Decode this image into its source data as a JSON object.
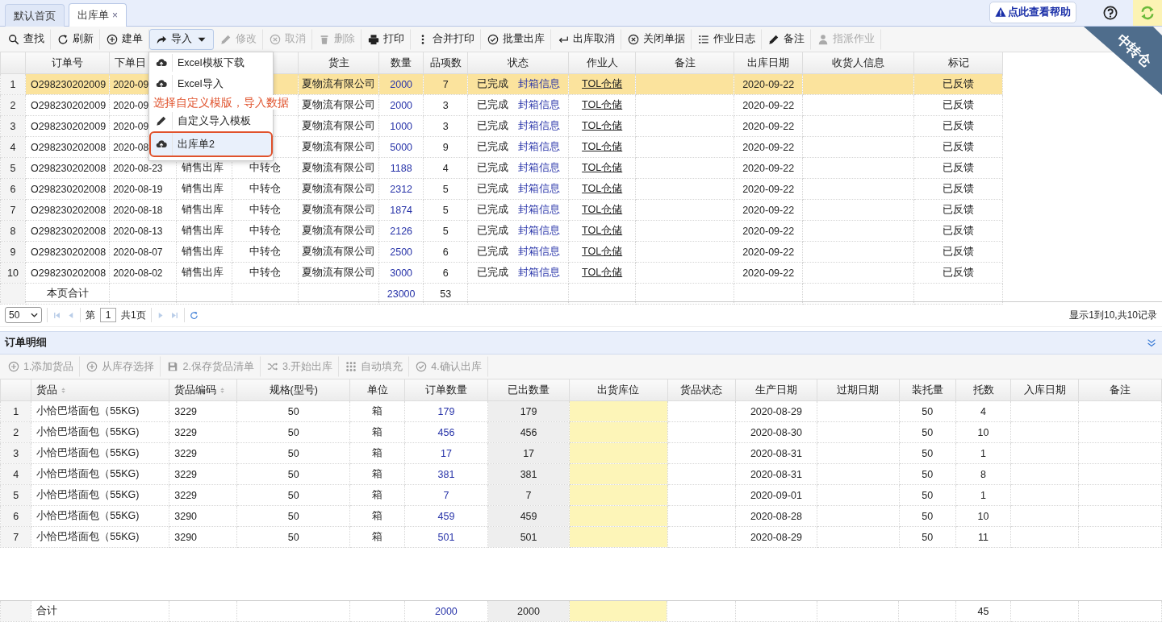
{
  "tabs": [
    {
      "label": "默认首页",
      "selected": false
    },
    {
      "label": "出库单",
      "selected": true,
      "close": "×"
    }
  ],
  "help": {
    "label": "点此查看帮助"
  },
  "ribbon": "中转仓",
  "toolbar": [
    {
      "label": "查找",
      "disabled": false,
      "expanded": false
    },
    {
      "label": "刷新",
      "disabled": false,
      "expanded": false
    },
    {
      "label": "建单",
      "disabled": false,
      "expanded": false
    },
    {
      "label": "导入",
      "disabled": false,
      "expanded": true
    },
    {
      "label": "修改",
      "disabled": true,
      "expanded": false
    },
    {
      "label": "取消",
      "disabled": true,
      "expanded": false
    },
    {
      "label": "删除",
      "disabled": true,
      "expanded": false
    },
    {
      "label": "打印",
      "disabled": false,
      "expanded": false
    },
    {
      "label": "合并打印",
      "disabled": false,
      "expanded": false
    },
    {
      "label": "批量出库",
      "disabled": false,
      "expanded": false
    },
    {
      "label": "出库取消",
      "disabled": false,
      "expanded": false
    },
    {
      "label": "关闭单据",
      "disabled": false,
      "expanded": false
    },
    {
      "label": "作业日志",
      "disabled": false,
      "expanded": false
    },
    {
      "label": "备注",
      "disabled": false,
      "expanded": false
    },
    {
      "label": "指派作业",
      "disabled": true,
      "expanded": false
    }
  ],
  "import_menu": [
    {
      "label": "Excel模板下载",
      "selected": false
    },
    {
      "label": "Excel导入",
      "selected": false
    },
    {
      "label": "自定义导入模板",
      "selected": false
    },
    {
      "label": "出库单2",
      "selected": true
    }
  ],
  "annotation": "选择自定义模版，导入数据",
  "orders": {
    "columns": {
      "order": "订单号",
      "date": "下单日",
      "owner": "货主",
      "qty": "数量",
      "items": "品项数",
      "status": "状态",
      "operator": "作业人",
      "note": "备注",
      "ship_date": "出库日期",
      "consignee": "收货人信息",
      "mark": "标记"
    },
    "rows": [
      {
        "selected": true,
        "no": "1",
        "order": "O298230202009",
        "date": "2020-09",
        "owner": "夏物流有限公司",
        "qty": "2000",
        "items": "7",
        "status": "已完成",
        "box_info": "封箱信息",
        "operator": "TOL仓储",
        "ship_date": "2020-09-22",
        "mark": "已反馈"
      },
      {
        "selected": false,
        "no": "2",
        "order": "O298230202009",
        "date": "2020-09",
        "owner": "夏物流有限公司",
        "qty": "2000",
        "items": "3",
        "status": "已完成",
        "box_info": "封箱信息",
        "operator": "TOL仓储",
        "ship_date": "2020-09-22",
        "mark": "已反馈"
      },
      {
        "selected": false,
        "no": "3",
        "order": "O298230202009",
        "date": "2020-09",
        "owner": "夏物流有限公司",
        "qty": "1000",
        "items": "3",
        "status": "已完成",
        "box_info": "封箱信息",
        "operator": "TOL仓储",
        "ship_date": "2020-09-22",
        "mark": "已反馈"
      },
      {
        "selected": false,
        "no": "4",
        "order": "O298230202008",
        "date": "2020-08",
        "owner": "夏物流有限公司",
        "qty": "5000",
        "items": "9",
        "status": "已完成",
        "box_info": "封箱信息",
        "operator": "TOL仓储",
        "ship_date": "2020-09-22",
        "mark": "已反馈"
      },
      {
        "selected": false,
        "no": "5",
        "order": "O298230202008",
        "date": "2020-08-23",
        "type": "销售出库",
        "warehouse": "中转仓",
        "owner": "夏物流有限公司",
        "qty": "1188",
        "items": "4",
        "status": "已完成",
        "box_info": "封箱信息",
        "operator": "TOL仓储",
        "ship_date": "2020-09-22",
        "mark": "已反馈"
      },
      {
        "selected": false,
        "no": "6",
        "order": "O298230202008",
        "date": "2020-08-19",
        "type": "销售出库",
        "warehouse": "中转仓",
        "owner": "夏物流有限公司",
        "qty": "2312",
        "items": "5",
        "status": "已完成",
        "box_info": "封箱信息",
        "operator": "TOL仓储",
        "ship_date": "2020-09-22",
        "mark": "已反馈"
      },
      {
        "selected": false,
        "no": "7",
        "order": "O298230202008",
        "date": "2020-08-18",
        "type": "销售出库",
        "warehouse": "中转仓",
        "owner": "夏物流有限公司",
        "qty": "1874",
        "items": "5",
        "status": "已完成",
        "box_info": "封箱信息",
        "operator": "TOL仓储",
        "ship_date": "2020-09-22",
        "mark": "已反馈"
      },
      {
        "selected": false,
        "no": "8",
        "order": "O298230202008",
        "date": "2020-08-13",
        "type": "销售出库",
        "warehouse": "中转仓",
        "owner": "夏物流有限公司",
        "qty": "2126",
        "items": "5",
        "status": "已完成",
        "box_info": "封箱信息",
        "operator": "TOL仓储",
        "ship_date": "2020-09-22",
        "mark": "已反馈"
      },
      {
        "selected": false,
        "no": "9",
        "order": "O298230202008",
        "date": "2020-08-07",
        "type": "销售出库",
        "warehouse": "中转仓",
        "owner": "夏物流有限公司",
        "qty": "2500",
        "items": "6",
        "status": "已完成",
        "box_info": "封箱信息",
        "operator": "TOL仓储",
        "ship_date": "2020-09-22",
        "mark": "已反馈"
      },
      {
        "selected": false,
        "no": "10",
        "order": "O298230202008",
        "date": "2020-08-02",
        "type": "销售出库",
        "warehouse": "中转仓",
        "owner": "夏物流有限公司",
        "qty": "3000",
        "items": "6",
        "status": "已完成",
        "box_info": "封箱信息",
        "operator": "TOL仓储",
        "ship_date": "2020-09-22",
        "mark": "已反馈"
      }
    ],
    "totals": {
      "label": "本页合计",
      "qty": "23000",
      "items": "53"
    }
  },
  "pagination": {
    "page_size": "50",
    "prefix": "第",
    "page": "1",
    "suffix": "共1页",
    "summary": "显示1到10,共10记录"
  },
  "detail": {
    "title": "订单明细",
    "toolbar": [
      {
        "label": "1.添加货品",
        "disabled": true
      },
      {
        "label": "从库存选择",
        "disabled": true
      },
      {
        "label": "2.保存货品清单",
        "disabled": true
      },
      {
        "label": "3.开始出库",
        "disabled": true
      },
      {
        "label": "自动填充",
        "disabled": true
      },
      {
        "label": "4.确认出库",
        "disabled": true
      }
    ],
    "columns": {
      "name": {
        "label": "货品",
        "sortable": true
      },
      "code": {
        "label": "货品编码",
        "sortable": true
      },
      "spec": {
        "label": "规格(型号)",
        "sortable": false
      },
      "unit": {
        "label": "单位",
        "sortable": false
      },
      "order_qty": {
        "label": "订单数量",
        "sortable": false
      },
      "shipped_qty": {
        "label": "已出数量",
        "sortable": false
      },
      "bin": {
        "label": "出货库位",
        "sortable": false
      },
      "goods_status": {
        "label": "货品状态",
        "sortable": false
      },
      "mfg_date": {
        "label": "生产日期",
        "sortable": false
      },
      "exp_date": {
        "label": "过期日期",
        "sortable": false
      },
      "pallet_qty": {
        "label": "装托量",
        "sortable": false
      },
      "pallets": {
        "label": "托数",
        "sortable": false
      },
      "in_date": {
        "label": "入库日期",
        "sortable": false
      },
      "note": {
        "label": "备注",
        "sortable": false
      }
    },
    "rows": [
      {
        "no": "1",
        "name": "小恰巴塔面包（55KG)",
        "code": "3229",
        "spec": "50",
        "unit": "箱",
        "order_qty": "179",
        "shipped_qty": "179",
        "mfg_date": "2020-08-29",
        "pallet_qty": "50",
        "pallets": "4"
      },
      {
        "no": "2",
        "name": "小恰巴塔面包（55KG)",
        "code": "3229",
        "spec": "50",
        "unit": "箱",
        "order_qty": "456",
        "shipped_qty": "456",
        "mfg_date": "2020-08-30",
        "pallet_qty": "50",
        "pallets": "10"
      },
      {
        "no": "3",
        "name": "小恰巴塔面包（55KG)",
        "code": "3229",
        "spec": "50",
        "unit": "箱",
        "order_qty": "17",
        "shipped_qty": "17",
        "mfg_date": "2020-08-31",
        "pallet_qty": "50",
        "pallets": "1"
      },
      {
        "no": "4",
        "name": "小恰巴塔面包（55KG)",
        "code": "3229",
        "spec": "50",
        "unit": "箱",
        "order_qty": "381",
        "shipped_qty": "381",
        "mfg_date": "2020-08-31",
        "pallet_qty": "50",
        "pallets": "8"
      },
      {
        "no": "5",
        "name": "小恰巴塔面包（55KG)",
        "code": "3229",
        "spec": "50",
        "unit": "箱",
        "order_qty": "7",
        "shipped_qty": "7",
        "mfg_date": "2020-09-01",
        "pallet_qty": "50",
        "pallets": "1"
      },
      {
        "no": "6",
        "name": "小恰巴塔面包（55KG)",
        "code": "3290",
        "spec": "50",
        "unit": "箱",
        "order_qty": "459",
        "shipped_qty": "459",
        "mfg_date": "2020-08-28",
        "pallet_qty": "50",
        "pallets": "10"
      },
      {
        "no": "7",
        "name": "小恰巴塔面包（55KG)",
        "code": "3290",
        "spec": "50",
        "unit": "箱",
        "order_qty": "501",
        "shipped_qty": "501",
        "mfg_date": "2020-08-29",
        "pallet_qty": "50",
        "pallets": "11"
      }
    ],
    "totals": {
      "label": "合计",
      "order_qty": "2000",
      "shipped_qty": "2000",
      "pallets": "45"
    }
  }
}
